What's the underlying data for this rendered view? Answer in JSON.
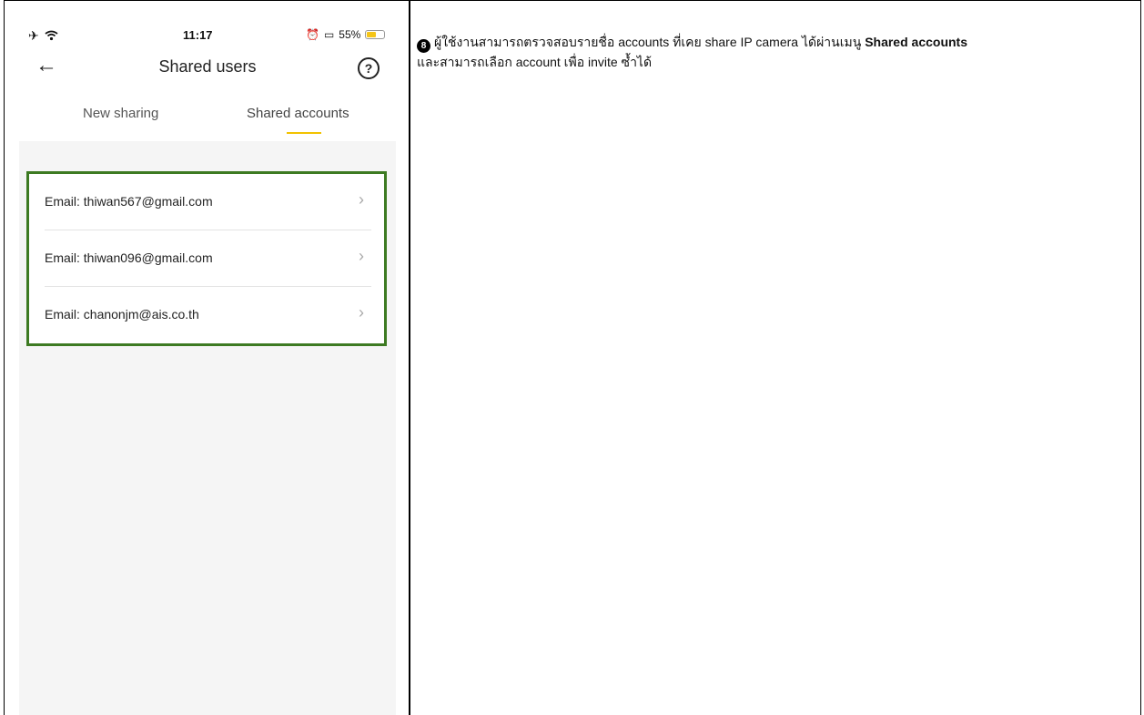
{
  "status_bar": {
    "time": "11:17",
    "battery_percent": "55%",
    "battery_level": 0.55
  },
  "nav": {
    "title": "Shared users"
  },
  "tabs": [
    {
      "label": "New sharing",
      "active": false
    },
    {
      "label": "Shared accounts",
      "active": true
    }
  ],
  "accounts": [
    {
      "label": "Email: thiwan567@gmail.com"
    },
    {
      "label": "Email: thiwan096@gmail.com"
    },
    {
      "label": "Email: chanonjm@ais.co.th"
    }
  ],
  "description": {
    "step_number": "8",
    "line1_part1": "ผู้ใช้งานสามารถตรวจสอบรายชื่อ accounts ที่เคย share IP camera ได้ผ่านเมนู ",
    "line1_bold": "Shared accounts",
    "line2": "และสามารถเลือก account เพื่อ invite ซ้ำได้"
  },
  "colors": {
    "highlight_border": "#3d7a22",
    "tab_underline": "#f2c200",
    "battery": "#f5c518"
  }
}
